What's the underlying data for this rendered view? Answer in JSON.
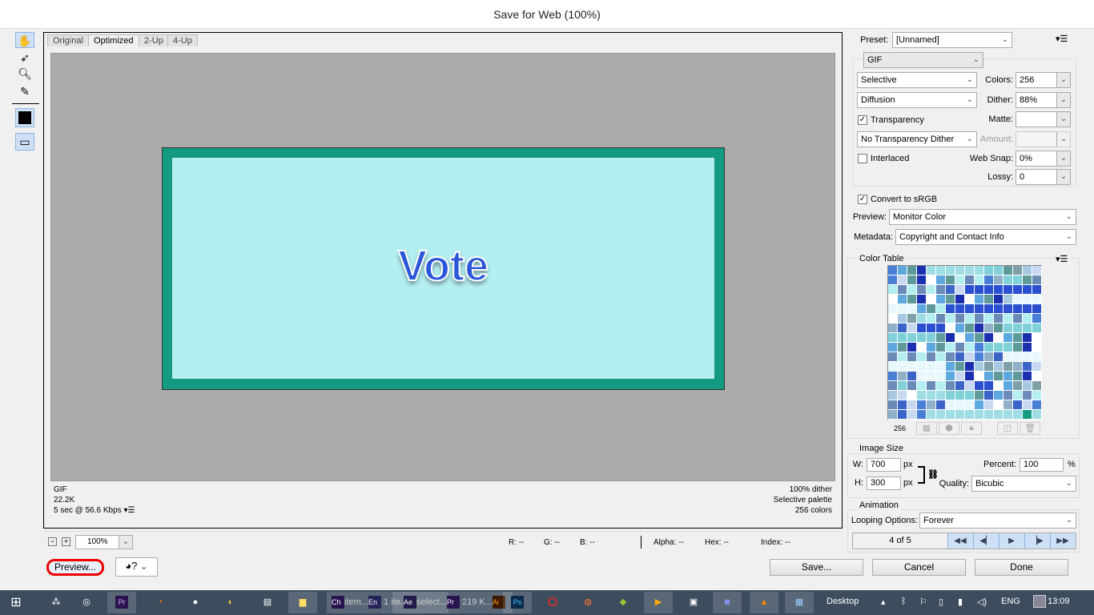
{
  "window": {
    "title": "Save for Web (100%)"
  },
  "tools": [
    "hand-tool",
    "slice-select-tool",
    "zoom-tool",
    "eyedropper-tool"
  ],
  "tabs": [
    "Original",
    "Optimized",
    "2-Up",
    "4-Up"
  ],
  "image": {
    "text": "Vote",
    "border_color": "#139a7f",
    "fill_color": "#b3eef0",
    "text_color": "#2a56d8"
  },
  "info": {
    "format": "GIF",
    "size": "22.2K",
    "time": "5 sec @ 56.6 Kbps",
    "dither": "100% dither",
    "palette": "Selective palette",
    "colors": "256 colors"
  },
  "zoombar": {
    "zoom": "100%",
    "r": "R: --",
    "g": "G: --",
    "b": "B: --",
    "alpha": "Alpha: --",
    "hex": "Hex: --",
    "index": "Index: --"
  },
  "buttons": {
    "preview": "Preview...",
    "save": "Save...",
    "cancel": "Cancel",
    "done": "Done"
  },
  "settings": {
    "preset_label": "Preset:",
    "preset": "[Unnamed]",
    "format": "GIF",
    "reduction": "Selective",
    "colors_label": "Colors:",
    "colors": "256",
    "dither_algo": "Diffusion",
    "dither_label": "Dither:",
    "dither": "88%",
    "transparency": "Transparency",
    "matte_label": "Matte:",
    "matte": "",
    "transparency_dither": "No Transparency Dither",
    "amount_label": "Amount:",
    "interlaced": "Interlaced",
    "websnap_label": "Web Snap:",
    "websnap": "0%",
    "lossy_label": "Lossy:",
    "lossy": "0",
    "convert_srgb": "Convert to sRGB",
    "preview_label": "Preview:",
    "preview": "Monitor Color",
    "metadata_label": "Metadata:",
    "metadata": "Copyright and Contact Info"
  },
  "color_table": {
    "title": "Color Table",
    "count": "256"
  },
  "image_size": {
    "title": "Image Size",
    "w_label": "W:",
    "w": "700",
    "h_label": "H:",
    "h": "300",
    "unit": "px",
    "percent_label": "Percent:",
    "percent": "100",
    "percent_unit": "%",
    "quality_label": "Quality:",
    "quality": "Bicubic"
  },
  "animation": {
    "title": "Animation",
    "looping_label": "Looping Options:",
    "looping": "Forever",
    "frame": "4 of 5"
  },
  "taskbar": {
    "labels": [
      "item...",
      "1 ite...",
      "select...",
      "219 K..."
    ],
    "desktop": "Desktop",
    "lang": "ENG",
    "time": "13:09"
  }
}
